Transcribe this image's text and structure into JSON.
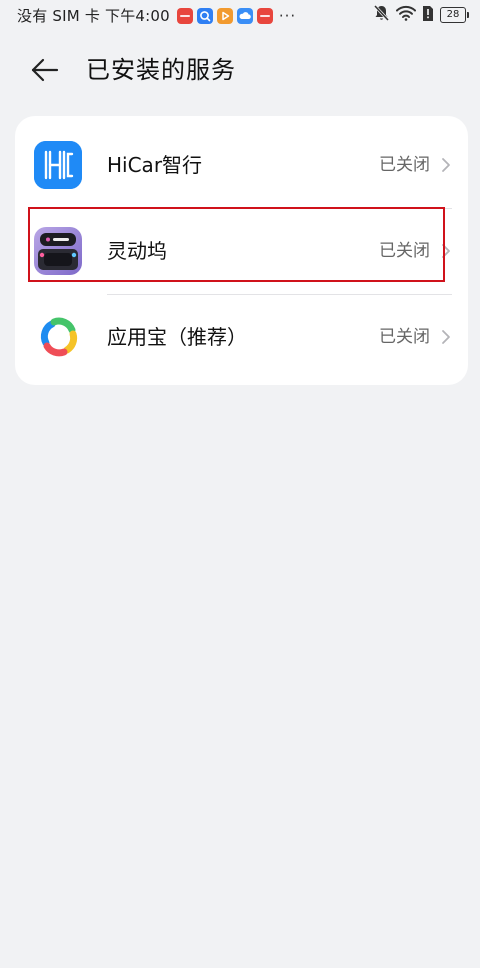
{
  "status_bar": {
    "carrier_text": "没有 SIM 卡 下午4:00",
    "more_indicator": "···",
    "battery_level": "28",
    "notification_icons": [
      "huawei-app-icon",
      "search-app-icon",
      "video-app-icon",
      "cloud-app-icon",
      "huawei-app-icon"
    ],
    "right_icons": [
      "mute-bell-icon",
      "wifi-icon",
      "sim-alert-icon",
      "battery-icon"
    ]
  },
  "header": {
    "title": "已安装的服务",
    "back_icon": "back-arrow-icon"
  },
  "services": [
    {
      "name": "HiCar智行",
      "status": "已关闭",
      "icon": "hicar-icon"
    },
    {
      "name": "灵动坞",
      "status": "已关闭",
      "icon": "lingdongwu-icon"
    },
    {
      "name": "应用宝（推荐）",
      "status": "已关闭",
      "icon": "yingyongbao-icon"
    }
  ],
  "colors": {
    "background": "#f1f2f4",
    "card": "#ffffff",
    "highlight": "#d0121b",
    "hicar_blue": "#1e88f5"
  }
}
